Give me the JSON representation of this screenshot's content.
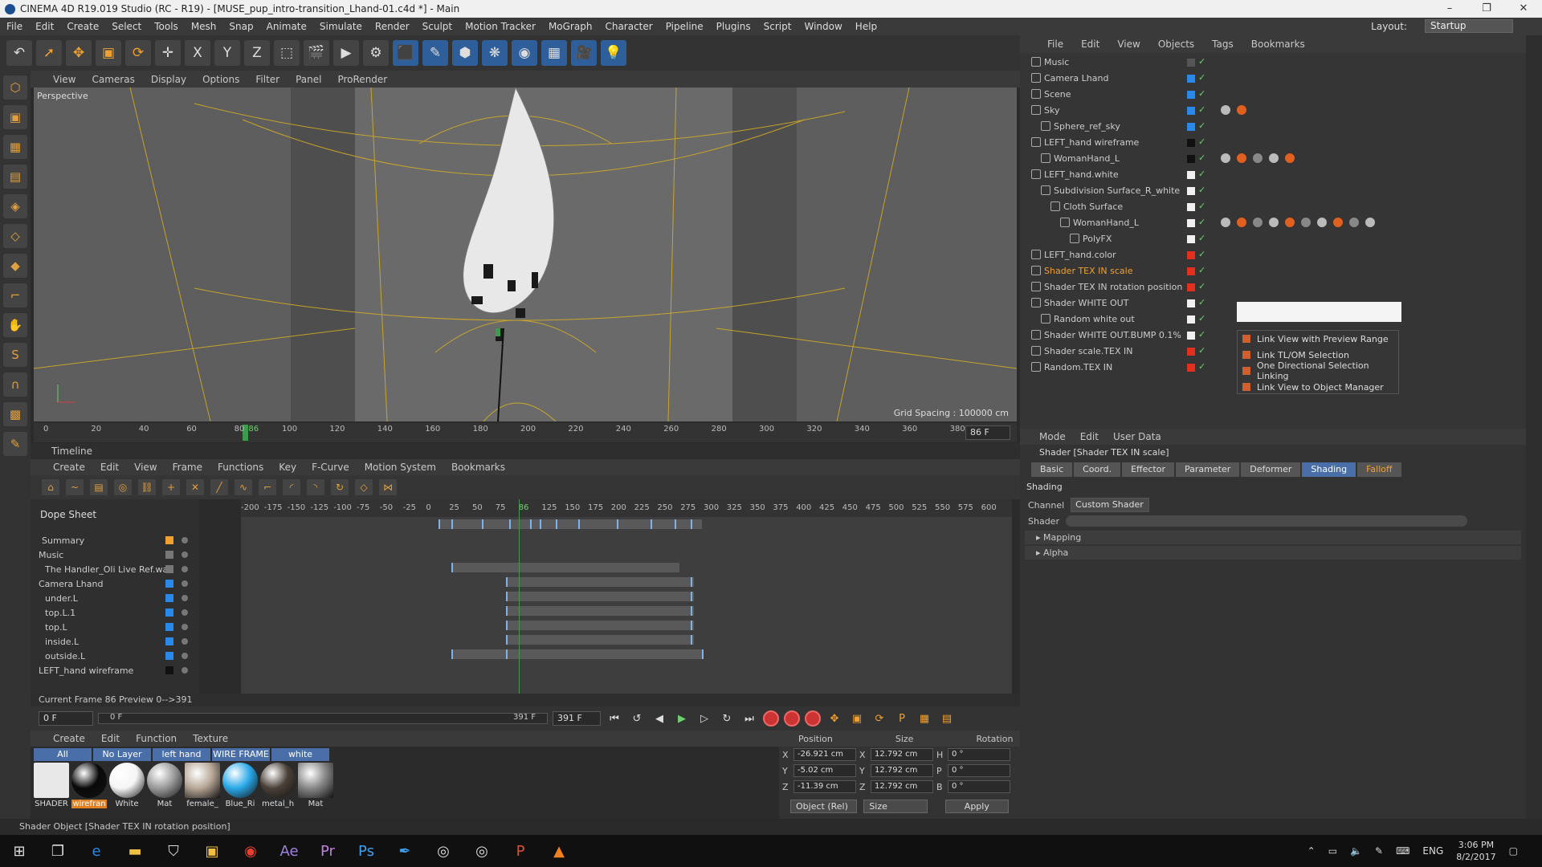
{
  "window": {
    "title": "CINEMA 4D R19.019 Studio (RC - R19) - [MUSE_pup_intro-transition_Lhand-01.c4d *] - Main",
    "min": "–",
    "max": "❐",
    "close": "✕"
  },
  "menu": [
    "File",
    "Edit",
    "Create",
    "Select",
    "Tools",
    "Mesh",
    "Snap",
    "Animate",
    "Simulate",
    "Render",
    "Sculpt",
    "Motion Tracker",
    "MoGraph",
    "Character",
    "Pipeline",
    "Plugins",
    "Script",
    "Window",
    "Help"
  ],
  "layout": {
    "label": "Layout:",
    "value": "Startup"
  },
  "toolbar": [
    "undo-icon",
    "select-icon",
    "move-icon",
    "scale-icon",
    "rotate-icon",
    "cross-icon",
    "x-axis-icon",
    "y-axis-icon",
    "z-axis-icon",
    "coord-icon",
    "render-view-icon",
    "render-icon",
    "render-settings-icon",
    "cube-icon",
    "pen-icon",
    "subdiv-icon",
    "cloner-icon",
    "deformer-icon",
    "floor-icon",
    "camera-icon",
    "light-icon"
  ],
  "toolbar_glyphs": [
    "↶",
    "➚",
    "✥",
    "▣",
    "⟳",
    "✛",
    "X",
    "Y",
    "Z",
    "⬚",
    "🎬",
    "▶",
    "⚙",
    "⬛",
    "✎",
    "⬢",
    "❋",
    "◉",
    "▦",
    "🎥",
    "💡"
  ],
  "viewport": {
    "menu": [
      "View",
      "Cameras",
      "Display",
      "Options",
      "Filter",
      "Panel",
      "ProRender"
    ],
    "label": "Perspective",
    "grid": "Grid Spacing : 100000 cm"
  },
  "ruler": {
    "ticks": [
      "0",
      "20",
      "40",
      "60",
      "80",
      "86",
      "100",
      "120",
      "140",
      "160",
      "180",
      "200",
      "220",
      "240",
      "260",
      "280",
      "300",
      "320",
      "340",
      "360",
      "380"
    ],
    "frame": "86 F"
  },
  "timeline": {
    "title": "Timeline",
    "menu": [
      "Create",
      "Edit",
      "View",
      "Frame",
      "Functions",
      "Key",
      "F-Curve",
      "Motion System",
      "Bookmarks"
    ],
    "dope_title": "Dope Sheet",
    "tracks": [
      "Summary",
      "Music",
      "The Handler_Oli Live Ref.wav",
      "Camera Lhand",
      "under.L",
      "top.L.1",
      "top.L",
      "inside.L",
      "outside.L",
      "LEFT_hand wireframe"
    ],
    "ticks": [
      "-200",
      "-175",
      "-150",
      "-125",
      "-100",
      "-75",
      "-50",
      "-25",
      "0",
      "25",
      "50",
      "75",
      "86",
      "125",
      "150",
      "175",
      "200",
      "225",
      "250",
      "275",
      "300",
      "325",
      "350",
      "375",
      "400",
      "425",
      "450",
      "475",
      "500",
      "525",
      "550",
      "575",
      "600"
    ],
    "status": "Current Frame  86  Preview  0-->391"
  },
  "transport": {
    "start": "0 F",
    "slider_a": "0 F",
    "slider_b": "391 F",
    "end": "391 F"
  },
  "materials": {
    "menu": [
      "Create",
      "Edit",
      "Function",
      "Texture"
    ],
    "filters": [
      "All",
      "No Layer",
      "left hand",
      "WIRE FRAME",
      "white"
    ],
    "items": [
      {
        "label": "SHADER",
        "color": "#e8e8e8"
      },
      {
        "label": "wirefran",
        "color": "#0a0a0a"
      },
      {
        "label": "White",
        "color": "#f5f5f5"
      },
      {
        "label": "Mat",
        "color": "#9a9a9a"
      },
      {
        "label": "female_",
        "color": "#b8a898"
      },
      {
        "label": "Blue_Ri",
        "color": "#2aa8e8"
      },
      {
        "label": "metal_h",
        "color": "#4a4038"
      },
      {
        "label": "Mat",
        "color": "#888888"
      }
    ]
  },
  "coords": {
    "headers": [
      "Position",
      "Size",
      "Rotation"
    ],
    "rows": [
      {
        "axis": "X",
        "pos": "-26.921 cm",
        "saxis": "X",
        "size": "12.792 cm",
        "raxis": "H",
        "rot": "0 °"
      },
      {
        "axis": "Y",
        "pos": "-5.02 cm",
        "saxis": "Y",
        "size": "12.792 cm",
        "raxis": "P",
        "rot": "0 °"
      },
      {
        "axis": "Z",
        "pos": "-11.39 cm",
        "saxis": "Z",
        "size": "12.792 cm",
        "raxis": "B",
        "rot": "0 °"
      }
    ],
    "mode": "Object (Rel)",
    "sizemode": "Size",
    "apply": "Apply"
  },
  "objects": {
    "menu": [
      "File",
      "Edit",
      "View",
      "Objects",
      "Tags",
      "Bookmarks"
    ],
    "rows": [
      {
        "name": "Music",
        "indent": 0,
        "color": "#555555"
      },
      {
        "name": "Camera Lhand",
        "indent": 0,
        "color": "#2a88e8"
      },
      {
        "name": "Scene",
        "indent": 0,
        "color": "#2a88e8"
      },
      {
        "name": "Sky",
        "indent": 0,
        "color": "#2a88e8"
      },
      {
        "name": "Sphere_ref_sky",
        "indent": 1,
        "color": "#2a88e8"
      },
      {
        "name": "LEFT_hand wireframe",
        "indent": 0,
        "color": "#111111"
      },
      {
        "name": "WomanHand_L",
        "indent": 1,
        "color": "#111111"
      },
      {
        "name": "LEFT_hand.white",
        "indent": 0,
        "color": "#f0f0f0"
      },
      {
        "name": "Subdivision Surface_R_white",
        "indent": 1,
        "color": "#f0f0f0"
      },
      {
        "name": "Cloth Surface",
        "indent": 2,
        "color": "#f0f0f0"
      },
      {
        "name": "WomanHand_L",
        "indent": 3,
        "color": "#f0f0f0"
      },
      {
        "name": "PolyFX",
        "indent": 4,
        "color": "#f0f0f0"
      },
      {
        "name": "LEFT_hand.color",
        "indent": 0,
        "color": "#e03020"
      },
      {
        "name": "Shader TEX IN scale",
        "indent": 0,
        "color": "#e03020",
        "hl": true
      },
      {
        "name": "Shader TEX IN rotation position",
        "indent": 0,
        "color": "#e03020"
      },
      {
        "name": "Shader WHITE OUT",
        "indent": 0,
        "color": "#f0f0f0"
      },
      {
        "name": "Random white out",
        "indent": 1,
        "color": "#f0f0f0"
      },
      {
        "name": "Shader WHITE OUT.BUMP 0.1%",
        "indent": 0,
        "color": "#f0f0f0"
      },
      {
        "name": "Shader scale.TEX IN",
        "indent": 0,
        "color": "#e03020"
      },
      {
        "name": "Random.TEX IN",
        "indent": 0,
        "color": "#e03020"
      }
    ]
  },
  "context_menu": [
    "Link View with Preview Range",
    "Link TL/OM Selection",
    "One Directional Selection Linking",
    "Link View to Object Manager"
  ],
  "attributes": {
    "menu": [
      "Mode",
      "Edit",
      "User Data"
    ],
    "title": "Shader [Shader TEX IN scale]",
    "tabs": [
      "Basic",
      "Coord.",
      "Effector",
      "Parameter",
      "Deformer",
      "Shading",
      "Falloff"
    ],
    "section": "Shading",
    "channel_label": "Channel",
    "channel_value": "Custom Shader",
    "shader_label": "Shader",
    "expanders": [
      "Mapping",
      "Alpha"
    ]
  },
  "statusbar": "Shader Object [Shader TEX IN rotation position]",
  "taskbar": {
    "lang": "ENG",
    "time": "3:06 PM",
    "date": "8/2/2017"
  },
  "colors": {
    "accent": "#4a6fa8",
    "orange": "#f0a030",
    "green": "#3c9c4c"
  }
}
